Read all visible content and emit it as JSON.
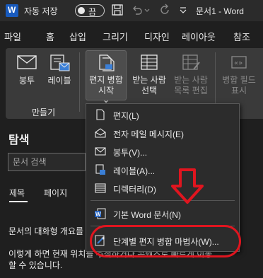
{
  "titlebar": {
    "app_logo": "W",
    "autosave_label": "자동 저장",
    "autosave_state": "끔",
    "doc_title": "문서1 - Word"
  },
  "tabs": [
    "파일",
    "홈",
    "삽입",
    "그리기",
    "디자인",
    "레이아웃",
    "참조"
  ],
  "ribbon": {
    "envelopes": "봉투",
    "labels": "레이블",
    "start_merge_line1": "편지 병합",
    "start_merge_line2": "시작",
    "select_recipients_line1": "받는 사람",
    "select_recipients_line2": "선택",
    "edit_recipients_line1": "받는 사람",
    "edit_recipients_line2": "목록 편집",
    "merge_field_line1": "병합 필드",
    "merge_field_line2": "표시",
    "group_create": "만들기",
    "dropdown_caret": "⌄"
  },
  "nav": {
    "title": "탐색",
    "search_placeholder": "문서 검색",
    "tab_headings": "제목",
    "tab_pages": "페이지",
    "text_line1": "문서의 대화형 개요를",
    "text_line2": "이렇게 하면 현재 위치를 추적하거나 콘텐츠로 빠르게 이동",
    "text_line3": "할 수 있습니다."
  },
  "menu": {
    "items": [
      {
        "label": "편지(L)",
        "icon": "letter-icon"
      },
      {
        "label": "전자 메일 메시지(E)",
        "icon": "email-message-icon"
      },
      {
        "label": "봉투(V)...",
        "icon": "envelope-icon"
      },
      {
        "label": "레이블(A)...",
        "icon": "label-icon"
      },
      {
        "label": "디렉터리(D)",
        "icon": "directory-icon"
      },
      {
        "label": "기본 Word 문서(N)",
        "icon": "word-document-icon"
      },
      {
        "label": "단계별 편지 병합 마법사(W)...",
        "icon": "wizard-icon"
      }
    ]
  },
  "colors": {
    "accent_word": "#185abd",
    "annotation_red": "#e0151f",
    "background": "#1f1f1f"
  }
}
